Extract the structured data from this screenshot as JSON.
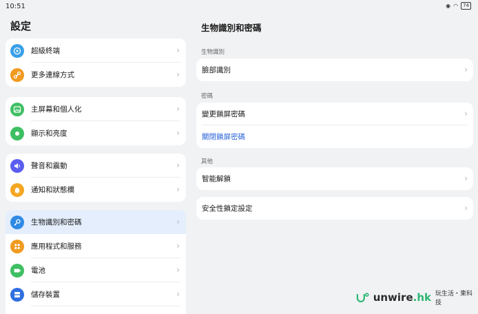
{
  "statusbar": {
    "time": "10:51",
    "battery": "74"
  },
  "left_panel": {
    "title": "設定",
    "groups": [
      {
        "items": [
          {
            "label": "超級終端",
            "icon": "super-device-icon",
            "color": "#3aa0e8"
          },
          {
            "label": "更多連線方式",
            "icon": "link-icon",
            "color": "#f09a21"
          }
        ]
      },
      {
        "items": [
          {
            "label": "主屏幕和個人化",
            "icon": "wallpaper-icon",
            "color": "#3fbf63"
          },
          {
            "label": "顯示和亮度",
            "icon": "display-icon",
            "color": "#3fbf63"
          }
        ]
      },
      {
        "items": [
          {
            "label": "聲音和震動",
            "icon": "sound-icon",
            "color": "#5b5ef0"
          },
          {
            "label": "通知和狀態欄",
            "icon": "bell-icon",
            "color": "#f5a623"
          }
        ]
      },
      {
        "items": [
          {
            "label": "生物識別和密碼",
            "icon": "key-icon",
            "color": "#2f8ae5",
            "selected": true
          },
          {
            "label": "應用程式和服務",
            "icon": "apps-icon",
            "color": "#f09a21"
          },
          {
            "label": "電池",
            "icon": "battery-icon",
            "color": "#3fbf63"
          },
          {
            "label": "儲存裝置",
            "icon": "storage-icon",
            "color": "#2f6fe0"
          }
        ]
      }
    ]
  },
  "right_panel": {
    "title": "生物識別和密碼",
    "sections": [
      {
        "label": "生物識別",
        "rows": [
          {
            "label": "臉部識別",
            "chevron": true
          }
        ]
      },
      {
        "label": "密碼",
        "rows": [
          {
            "label": "變更鎖屏密碼",
            "chevron": true
          },
          {
            "label": "關閉鎖屏密碼",
            "chevron": false,
            "color": "#2b63d9"
          }
        ]
      },
      {
        "label": "其他",
        "rows": [
          {
            "label": "智能解鎖",
            "chevron": true
          }
        ]
      },
      {
        "label": "",
        "rows": [
          {
            "label": "安全性鎖定設定",
            "chevron": true
          }
        ]
      }
    ]
  },
  "watermark": {
    "brand": "unwire",
    "ext": ".hk",
    "tagline": "玩生活・柬科技"
  }
}
